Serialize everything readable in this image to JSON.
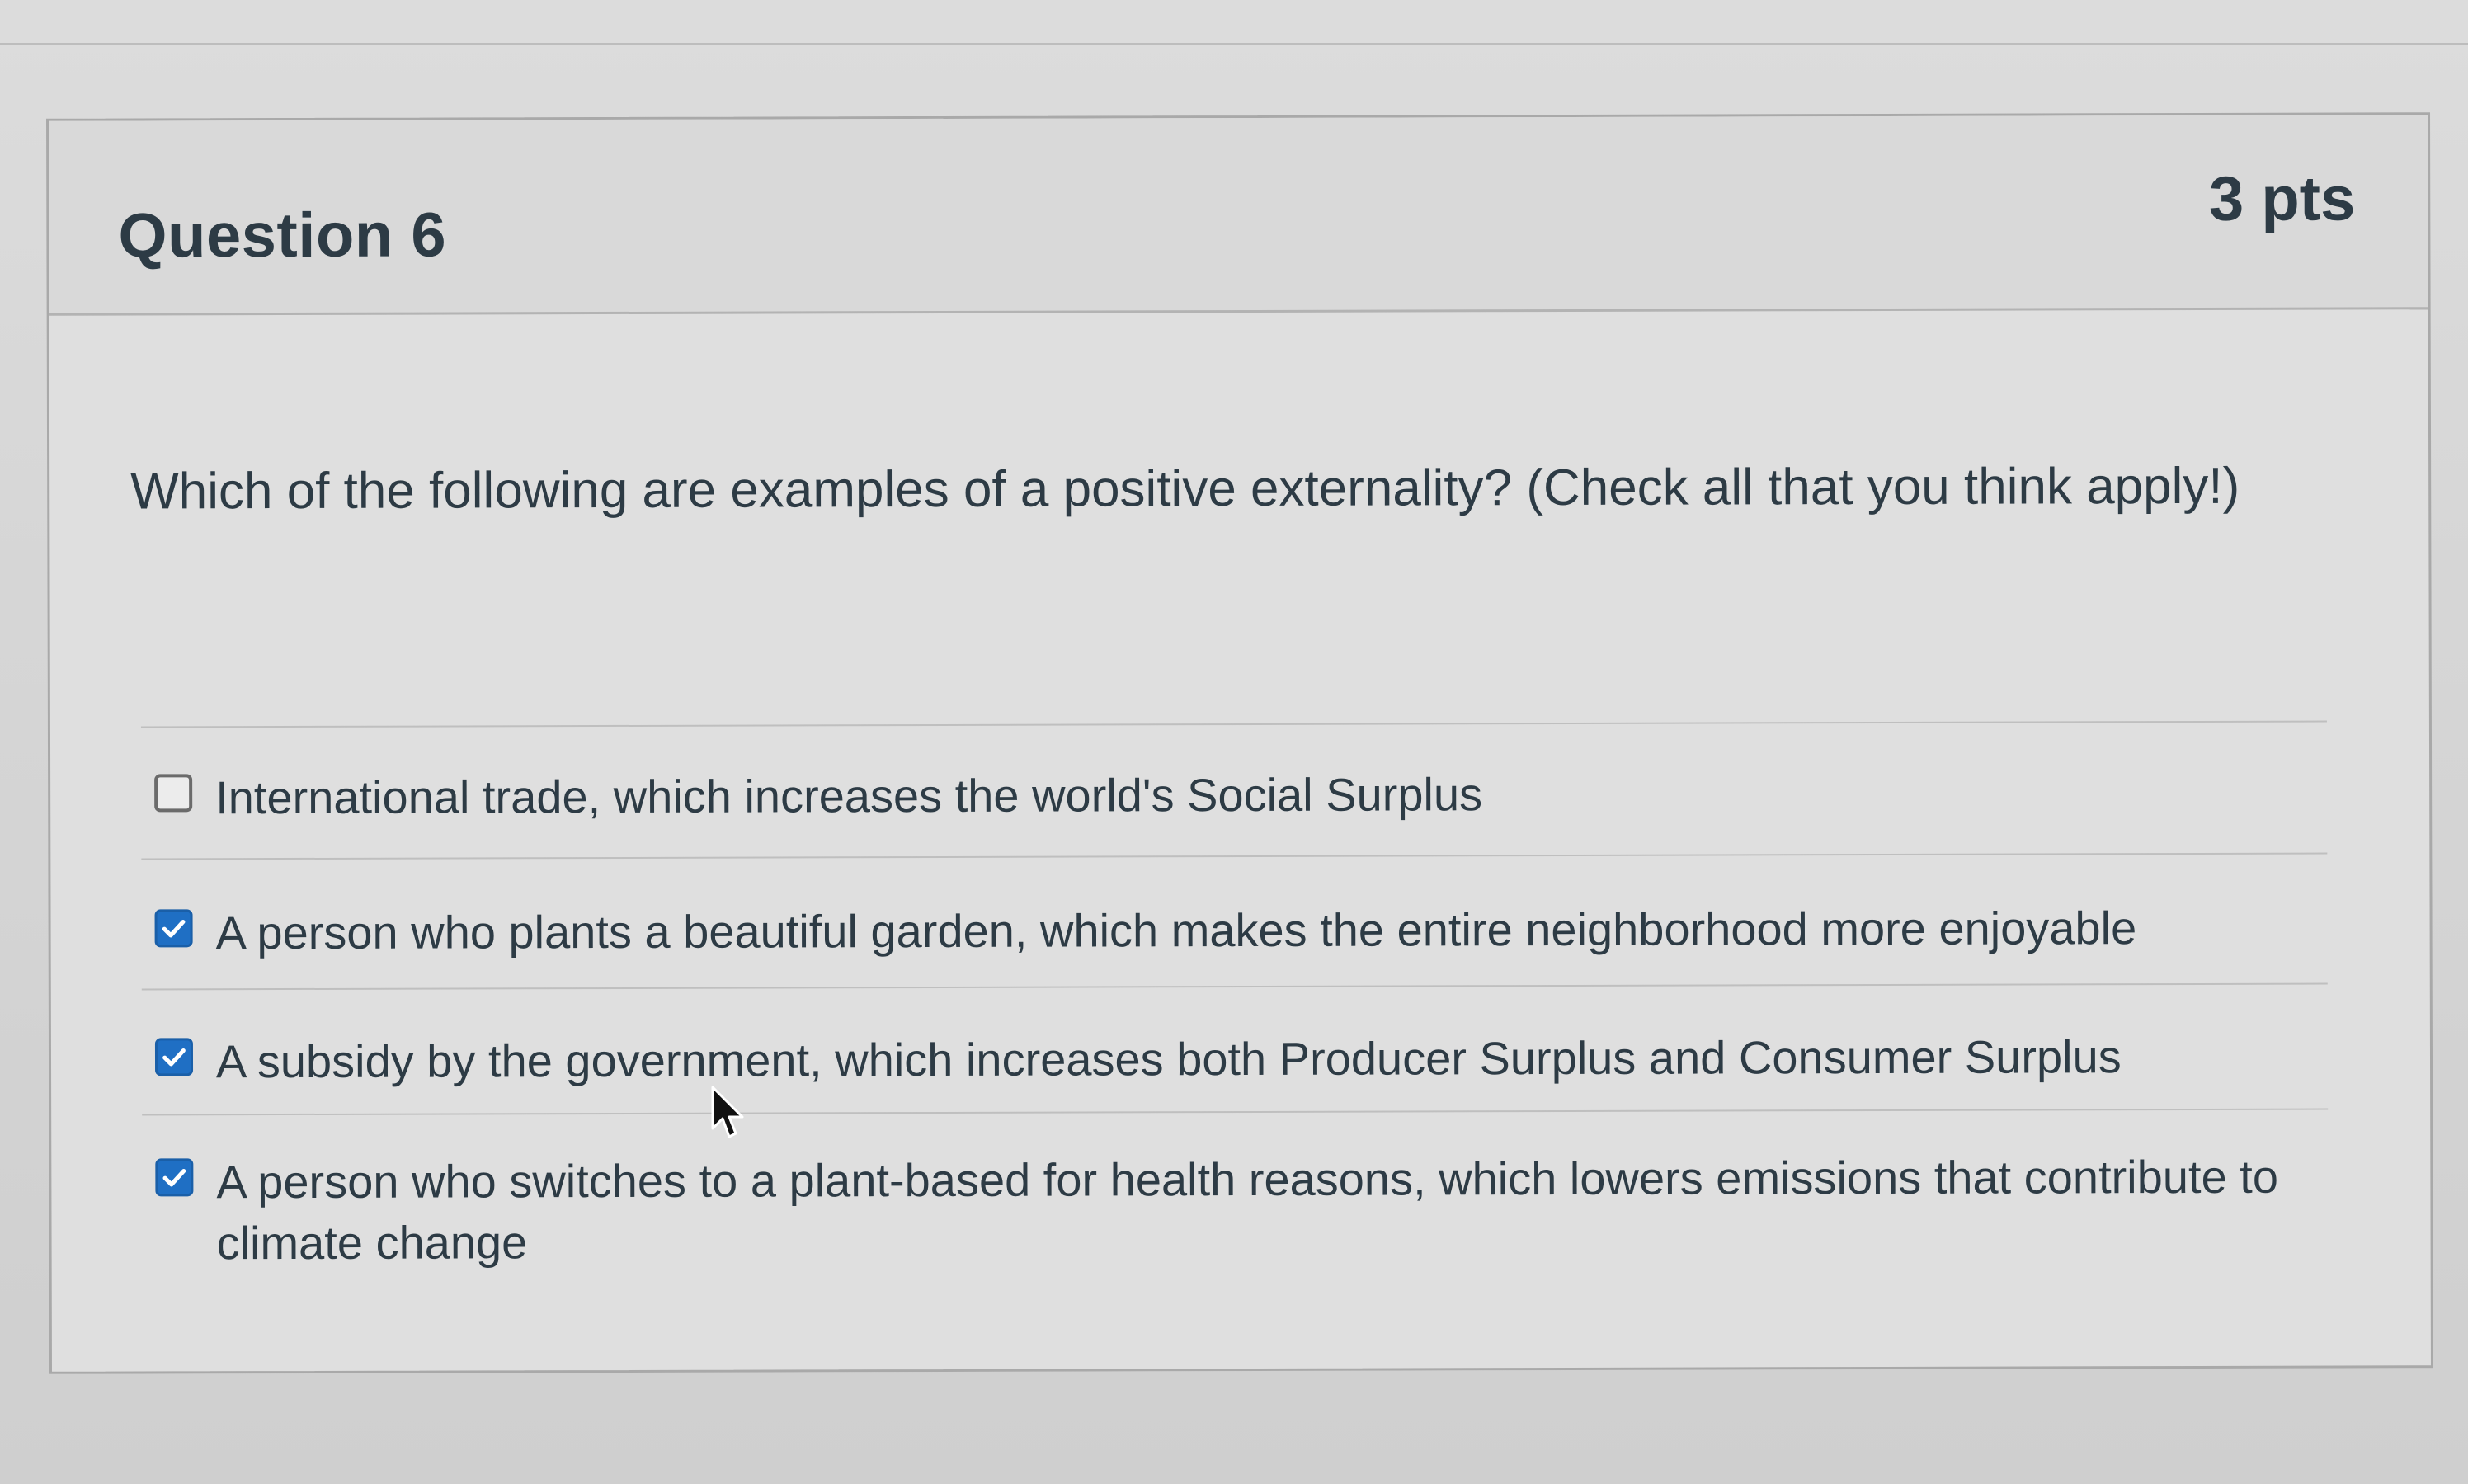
{
  "question": {
    "title": "Question 6",
    "points": "3 pts",
    "text": "Which of the following are examples of a positive externality? (Check all that you think apply!)"
  },
  "answers": [
    {
      "label": "International trade, which increases the world's Social Surplus",
      "checked": false
    },
    {
      "label": "A person who plants a beautiful garden, which makes the entire neighborhood more enjoyable",
      "checked": true
    },
    {
      "label": "A subsidy by the government, which increases both Producer Surplus and Consumer Surplus",
      "checked": true
    },
    {
      "label": "A person who switches to a plant-based for health reasons, which lowers emissions that contribute to climate change",
      "checked": true
    }
  ],
  "colors": {
    "checkbox_checked": "#1f6fc4",
    "text": "#2d3b45"
  },
  "icons": {
    "checked": "checkmark-icon",
    "cursor": "mouse-pointer-icon"
  }
}
